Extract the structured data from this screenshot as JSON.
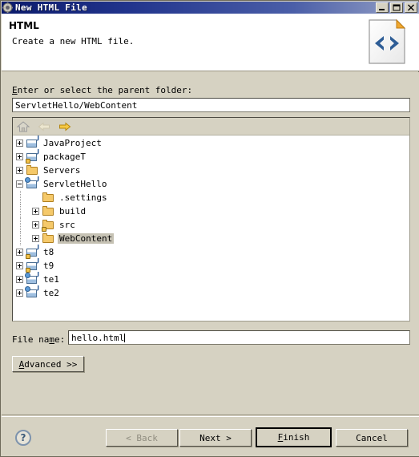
{
  "window": {
    "title": "New HTML File",
    "title_icon": "gear-icon",
    "controls": {
      "minimize": "_",
      "maximize": "□",
      "close": "×"
    }
  },
  "header": {
    "title": "HTML",
    "description": "Create a new HTML file.",
    "icon": "html-file-icon"
  },
  "form": {
    "parent_label_mnemonic": "E",
    "parent_label_rest": "nter or select the parent folder:",
    "parent_value": "ServletHello/WebContent",
    "file_label_pre": "File na",
    "file_label_mnemonic": "m",
    "file_label_post": "e:",
    "file_value": "hello.html"
  },
  "tree_toolbar": {
    "home_icon": "home-icon",
    "back_icon": "arrow-left-icon",
    "forward_icon": "arrow-right-icon"
  },
  "tree": {
    "rows": [
      {
        "label": "JavaProject",
        "indent": 0,
        "twisty": "plus",
        "icon": "project-folder-icon",
        "selected": false
      },
      {
        "label": "packageT",
        "indent": 0,
        "twisty": "plus",
        "icon": "project-folder-locked-icon",
        "selected": false
      },
      {
        "label": "Servers",
        "indent": 0,
        "twisty": "plus",
        "icon": "folder-icon",
        "selected": false
      },
      {
        "label": "ServletHello",
        "indent": 0,
        "twisty": "minus",
        "icon": "web-project-folder-icon",
        "selected": false
      },
      {
        "label": ".settings",
        "indent": 1,
        "twisty": "none",
        "icon": "folder-icon",
        "selected": false
      },
      {
        "label": "build",
        "indent": 1,
        "twisty": "plus",
        "icon": "folder-icon",
        "selected": false
      },
      {
        "label": "src",
        "indent": 1,
        "twisty": "plus",
        "icon": "folder-locked-icon",
        "selected": false
      },
      {
        "label": "WebContent",
        "indent": 1,
        "twisty": "plus",
        "icon": "folder-icon",
        "selected": true
      },
      {
        "label": "t8",
        "indent": 0,
        "twisty": "plus",
        "icon": "project-folder-locked-icon",
        "selected": false
      },
      {
        "label": "t9",
        "indent": 0,
        "twisty": "plus",
        "icon": "project-folder-locked-icon",
        "selected": false
      },
      {
        "label": "te1",
        "indent": 0,
        "twisty": "plus",
        "icon": "web-project-folder-icon",
        "selected": false
      },
      {
        "label": "te2",
        "indent": 0,
        "twisty": "plus",
        "icon": "web-project-folder-icon",
        "selected": false
      }
    ]
  },
  "buttons": {
    "advanced_mnemonic": "A",
    "advanced_rest": "dvanced >>",
    "back": "< Back",
    "next": "Next >",
    "finish_mnemonic": "F",
    "finish_rest": "inish",
    "cancel": "Cancel",
    "help_icon": "question-mark-icon"
  },
  "colors": {
    "dialog_bg": "#d6d2c2",
    "title_bar_start": "#0b1a6b",
    "title_bar_end": "#9aa5c8",
    "selection": "#c6c2b4",
    "folder": "#f5c96a",
    "html_icon_accent": "#2e5d96"
  }
}
